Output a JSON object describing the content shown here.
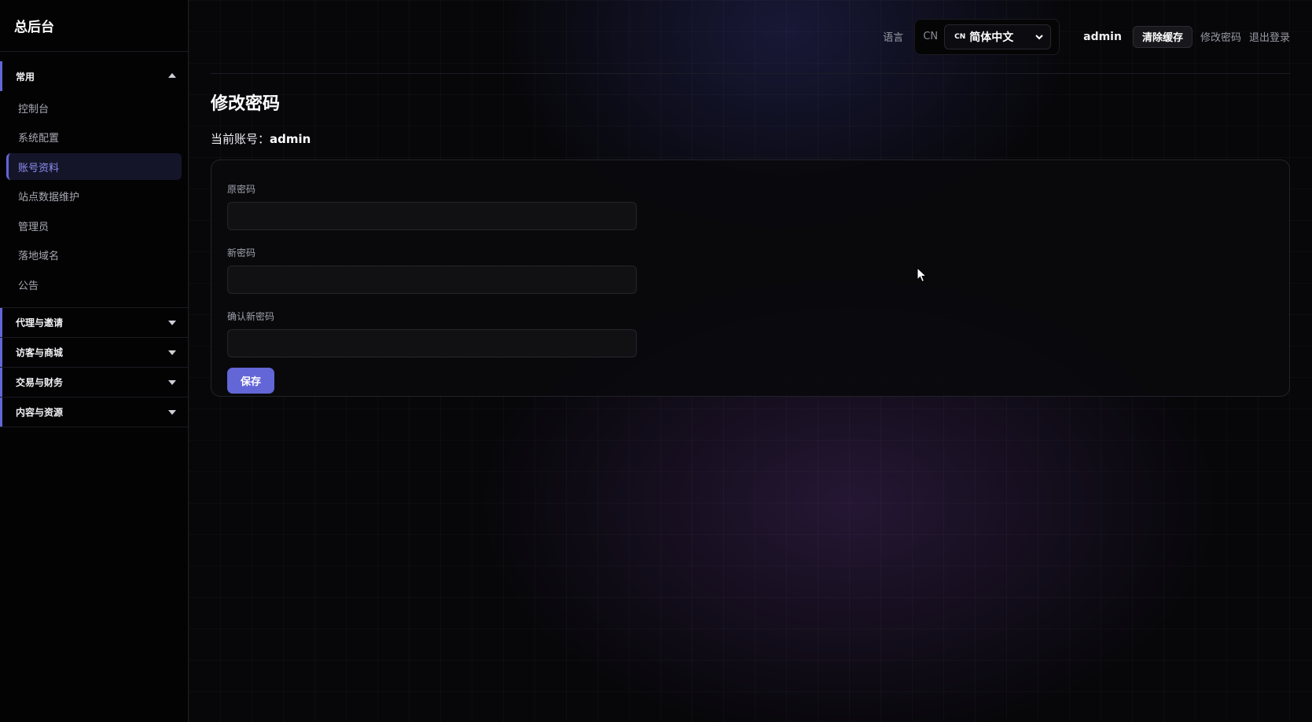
{
  "sidebar": {
    "brand": "总后台",
    "groups": [
      {
        "label": "常用",
        "expanded": true,
        "items": [
          {
            "label": "控制台"
          },
          {
            "label": "系统配置"
          },
          {
            "label": "账号资料",
            "active": true
          },
          {
            "label": "站点数据维护"
          },
          {
            "label": "管理员"
          },
          {
            "label": "落地域名"
          },
          {
            "label": "公告"
          }
        ]
      },
      {
        "label": "代理与邀请",
        "expanded": false
      },
      {
        "label": "访客与商城",
        "expanded": false
      },
      {
        "label": "交易与财务",
        "expanded": false
      },
      {
        "label": "内容与资源",
        "expanded": false
      }
    ]
  },
  "topbar": {
    "language_label": "语言",
    "language_code": "CN",
    "language_select": {
      "code": "CN",
      "value": "简体中文"
    },
    "username": "admin",
    "clear_cache": "清除缓存",
    "change_password": "修改密码",
    "logout": "退出登录"
  },
  "page": {
    "title": "修改密码",
    "account_prefix": "当前账号：",
    "account_name": "admin"
  },
  "form": {
    "old_password_label": "原密码",
    "new_password_label": "新密码",
    "confirm_password_label": "确认新密码",
    "old_password_value": "",
    "new_password_value": "",
    "confirm_password_value": "",
    "save_label": "保存"
  },
  "colors": {
    "accent": "#6366d6",
    "active_text": "#8c8ff0",
    "background": "#07070a"
  },
  "icons": {
    "group_expanded": "caret-up-icon",
    "group_collapsed": "caret-down-icon",
    "select": "chevron-down-icon",
    "cursor": "mouse-pointer-icon"
  }
}
